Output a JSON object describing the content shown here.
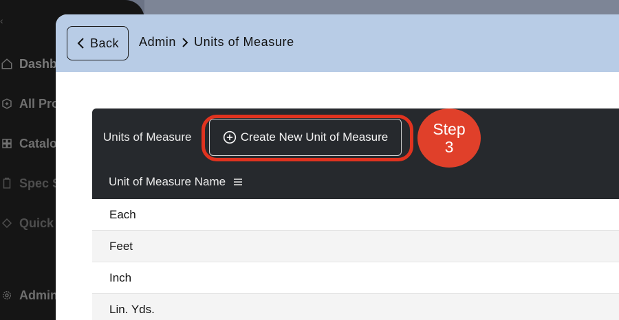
{
  "sidebar": {
    "items": [
      {
        "label": "Dashb",
        "icon": "home-icon"
      },
      {
        "label": "All Pro",
        "icon": "box-plus-icon"
      },
      {
        "label": "Catalo",
        "icon": "grid-icon"
      },
      {
        "label": "Spec S",
        "icon": "clipboard-icon"
      },
      {
        "label": "Quick",
        "icon": "arrow-icon"
      },
      {
        "label": "Admin",
        "icon": "gear-icon"
      }
    ]
  },
  "header": {
    "back_label": "Back",
    "breadcrumb": [
      "Admin",
      "Units of Measure"
    ]
  },
  "toolbar": {
    "title": "Units of Measure",
    "create_label": "Create New Unit of Measure"
  },
  "step_badge": {
    "word": "Step",
    "number": "3",
    "color": "#e0402a"
  },
  "table": {
    "column_header": "Unit of Measure Name",
    "rows": [
      "Each",
      "Feet",
      "Inch",
      "Lin. Yds."
    ]
  },
  "colors": {
    "header_bg": "#b8cce6",
    "toolbar_bg": "#26292d",
    "highlight": "#e0331f"
  }
}
